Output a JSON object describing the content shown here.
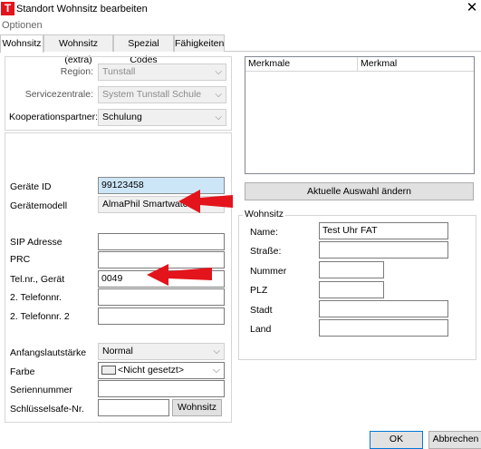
{
  "window": {
    "title": "Standort Wohnsitz bearbeiten",
    "close": "✕",
    "app_icon": "T"
  },
  "menu": {
    "optionen": "Optionen"
  },
  "tabs": [
    {
      "label": "Wohnsitz",
      "active": true
    },
    {
      "label": "Wohnsitz (extra)"
    },
    {
      "label": "Spezial Codes"
    },
    {
      "label": "Fähigkeiten"
    }
  ],
  "top_section": {
    "region_label": "Region:",
    "region_value": "Tunstall",
    "servicezentrale_label": "Servicezentrale:",
    "servicezentrale_value": "System Tunstall Schule",
    "kooperationspartner_label": "Kooperationspartner:",
    "kooperationspartner_value": "Schulung"
  },
  "device": {
    "geraete_id_label": "Geräte ID",
    "geraete_id_value": "99123458",
    "geraetemodell_label": "Gerätemodell",
    "geraetemodell_value": "AlmaPhil Smartwatch",
    "sip_label": "SIP Adresse",
    "prc_label": "PRC",
    "telnr_label": "Tel.nr., Gerät",
    "telnr_value": "0049",
    "tel2_label": "2. Telefonnr.",
    "tel3_label": "2. Telefonnr. 2",
    "lautstaerke_label": "Anfangslautstärke",
    "lautstaerke_value": "Normal",
    "farbe_label": "Farbe",
    "farbe_value": "<Nicht gesetzt>",
    "seriennummer_label": "Seriennummer",
    "schluessel_label": "Schlüsselsafe-Nr.",
    "wohnsitz_button": "Wohnsitz"
  },
  "merkmale": {
    "col1": "Merkmale",
    "col2": "Merkmal",
    "button": "Aktuelle Auswahl ändern"
  },
  "wohnsitz": {
    "group_label": "Wohnsitz",
    "name_label": "Name:",
    "name_value": "Test Uhr FAT",
    "strasse_label": "Straße:",
    "nummer_label": "Nummer",
    "plz_label": "PLZ",
    "stadt_label": "Stadt",
    "land_label": "Land"
  },
  "footer": {
    "ok": "OK",
    "abbrechen": "Abbrechen"
  },
  "colors": {
    "annotation_arrow": "#e3141b",
    "selected_field": "#cde6f7"
  }
}
